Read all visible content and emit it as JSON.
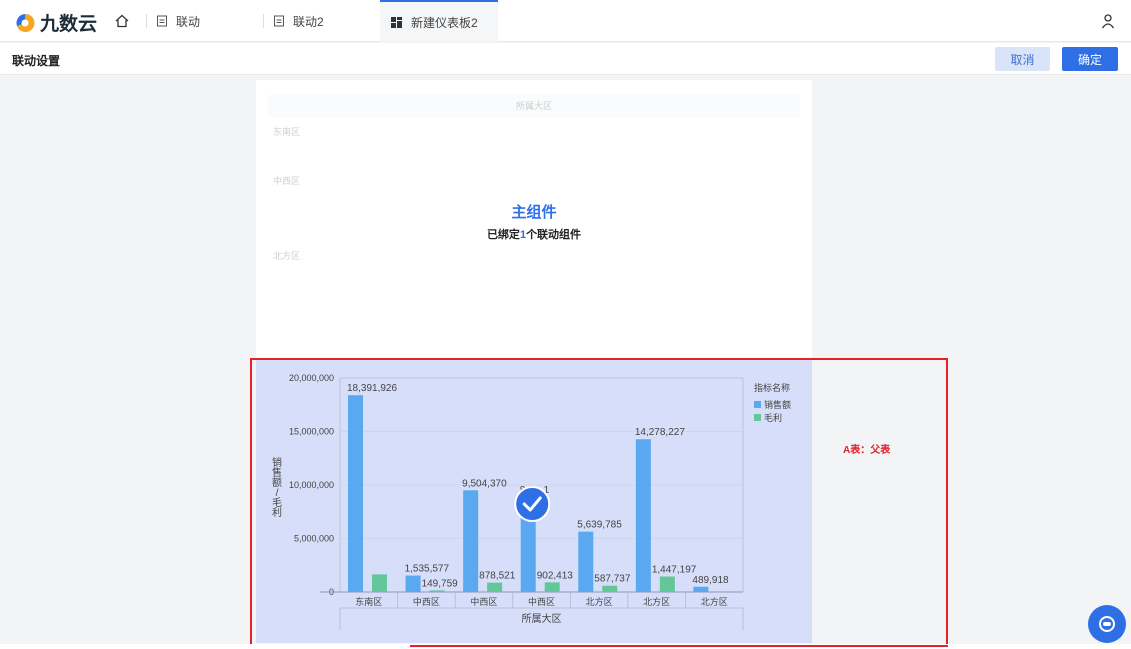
{
  "app": {
    "logo_text": "九数云"
  },
  "tabs": [
    {
      "label": "联动"
    },
    {
      "label": "联动2"
    },
    {
      "label": "新建仪表板2"
    }
  ],
  "subbar": {
    "title": "联动设置",
    "cancel_label": "取消",
    "confirm_label": "确定"
  },
  "main_component": {
    "header": "所属大区",
    "rows": [
      "东南区",
      "中西区",
      "北方区"
    ],
    "title": "主组件",
    "subtitle_pre": "已绑定",
    "subtitle_count": "1",
    "subtitle_post": "个联动组件"
  },
  "side_label": "A表：父表",
  "colors": {
    "accent": "#2f6fe6",
    "sales": "#5aa9f0",
    "profit": "#63c79a",
    "highlight": "#e0242b"
  },
  "chart_data": {
    "type": "bar",
    "categories": [
      "东南区",
      "中西区",
      "中西区",
      "中西区",
      "北方区",
      "北方区",
      "北方区"
    ],
    "series": [
      {
        "name": "销售额",
        "values": [
          18391926,
          1535577,
          9504370,
          8900000,
          5639785,
          14278227,
          489918
        ],
        "labels": [
          "18,391,926",
          "1,535,577",
          "9,504,370",
          "8,9…1",
          "5,639,785",
          "14,278,227",
          "489,918"
        ]
      },
      {
        "name": "毛利",
        "values": [
          1650000,
          149759,
          878521,
          902413,
          587737,
          1447197,
          60000
        ],
        "labels": [
          "",
          "149,759",
          "878,521",
          "902,413",
          "587,737",
          "1,447,197",
          ""
        ]
      }
    ],
    "yticks": [
      "20,000,000",
      "15,000,000",
      "10,000,000",
      "5,000,000",
      "0"
    ],
    "ylim": [
      0,
      20000000
    ],
    "xlabel": "所属大区",
    "ylabel": "销售额/毛利",
    "legend_title": "指标名称",
    "legend_position": "top-right",
    "selected_index": 3
  }
}
